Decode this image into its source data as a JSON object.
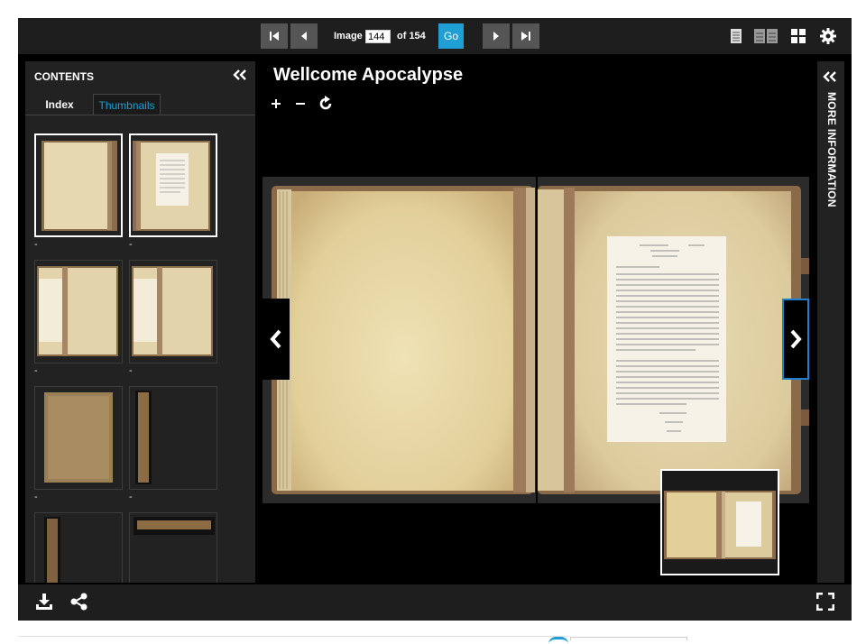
{
  "toolbar": {
    "image_label": "Image",
    "current_image": "144",
    "of_label": "of 154",
    "go_label": "Go"
  },
  "title": "Wellcome Apocalypse",
  "contents": {
    "heading": "CONTENTS",
    "tabs": [
      {
        "label": "Index",
        "active": false
      },
      {
        "label": "Thumbnails",
        "active": true
      }
    ],
    "thumbnails": [
      {
        "label": "-",
        "selected": true
      },
      {
        "label": "-",
        "selected": true
      },
      {
        "label": "-",
        "selected": false
      },
      {
        "label": "-",
        "selected": false
      },
      {
        "label": "-",
        "selected": false
      },
      {
        "label": "-",
        "selected": false
      },
      {
        "label": "",
        "selected": false
      },
      {
        "label": "",
        "selected": false
      }
    ]
  },
  "more_info": {
    "label": "MORE INFORMATION"
  },
  "icons": [
    "first-page-icon",
    "prev-page-icon",
    "next-page-icon",
    "last-page-icon",
    "one-up-view-icon",
    "two-up-view-icon",
    "gallery-view-icon",
    "settings-icon",
    "collapse-icon",
    "zoom-in-icon",
    "zoom-out-icon",
    "rotate-icon",
    "download-icon",
    "share-icon",
    "fullscreen-icon"
  ],
  "colors": {
    "accent": "#1f9fd3",
    "background": "#000000",
    "panel": "#222222",
    "toolbar": "#1e1e1e"
  }
}
